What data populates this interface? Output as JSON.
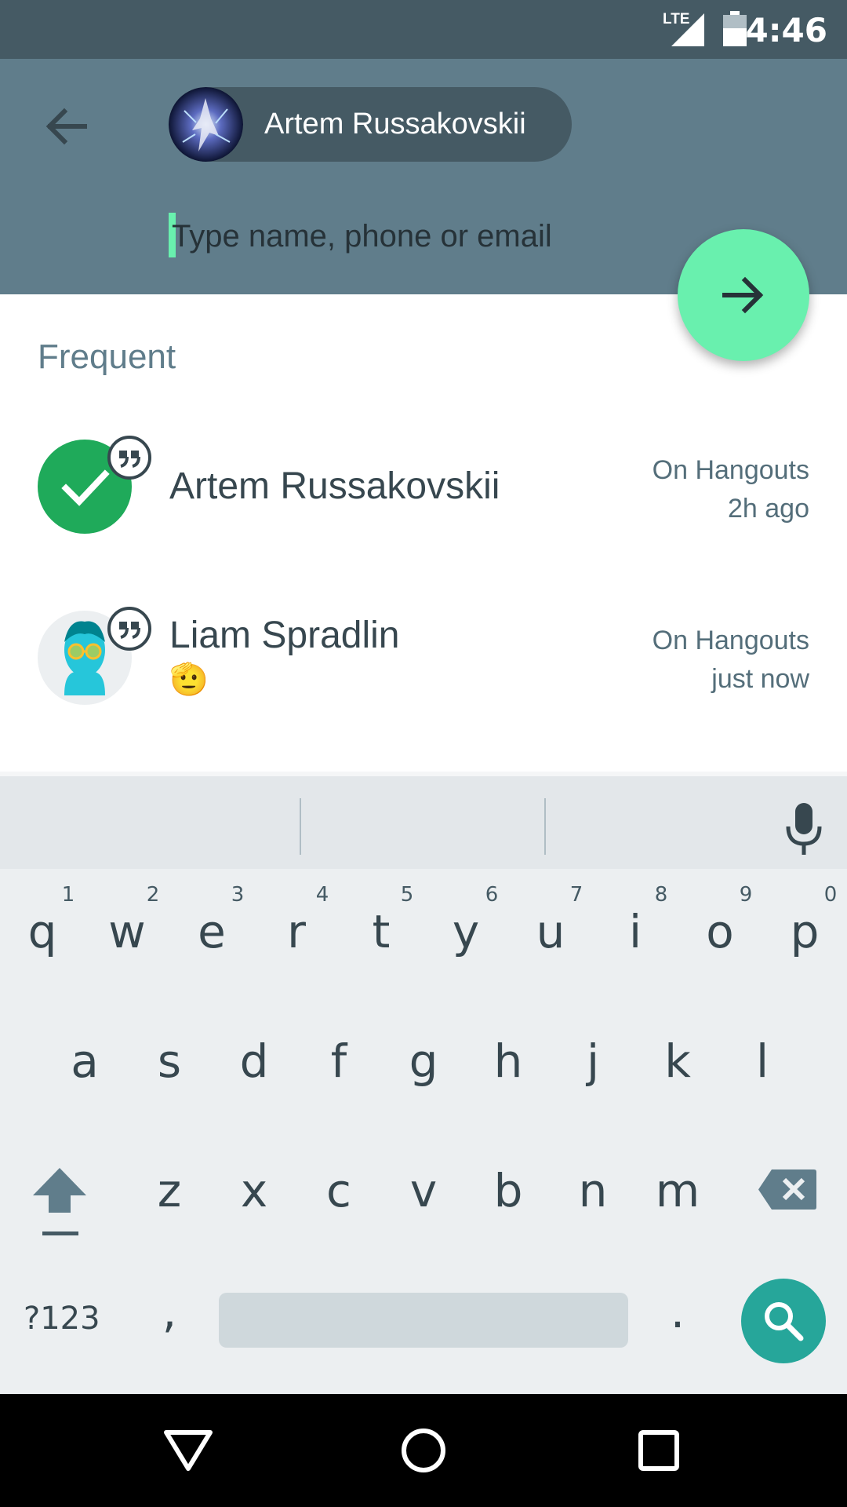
{
  "status_bar": {
    "time": "4:46",
    "network": "LTE"
  },
  "header": {
    "selected_chip_name": "Artem Russakovskii",
    "search_placeholder": "Type name, phone or email"
  },
  "section_title": "Frequent",
  "contacts": [
    {
      "name": "Artem Russakovskii",
      "status_line1": "On Hangouts",
      "status_line2": "2h ago",
      "selected": true
    },
    {
      "name": "Liam Spradlin",
      "status_line1": "On Hangouts",
      "status_line2": "just now",
      "emoji": "🫡",
      "selected": false
    }
  ],
  "keyboard": {
    "row1": [
      "q",
      "w",
      "e",
      "r",
      "t",
      "y",
      "u",
      "i",
      "o",
      "p"
    ],
    "row1_hints": [
      "1",
      "2",
      "3",
      "4",
      "5",
      "6",
      "7",
      "8",
      "9",
      "0"
    ],
    "row2": [
      "a",
      "s",
      "d",
      "f",
      "g",
      "h",
      "j",
      "k",
      "l"
    ],
    "row3": [
      "z",
      "x",
      "c",
      "v",
      "b",
      "n",
      "m"
    ],
    "symbols_label": "?123",
    "comma": ",",
    "period": "."
  },
  "colors": {
    "header": "#607d8b",
    "status_bar": "#455a64",
    "fab": "#69f0ae",
    "selected_avatar": "#1faa5a",
    "search_key": "#26a69a"
  }
}
